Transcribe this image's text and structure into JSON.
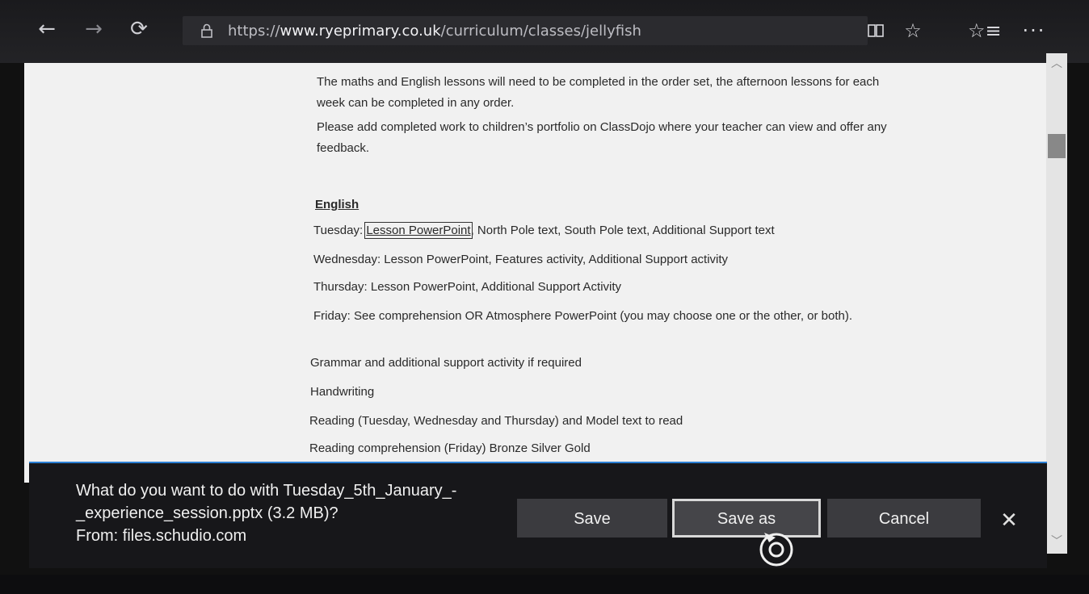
{
  "browser": {
    "url_prefix": "https://",
    "url_domain": "www.ryeprimary.co.uk",
    "url_path": "/curriculum/classes/jellyfish",
    "icons": {
      "back": "back-arrow-icon",
      "forward": "forward-arrow-icon",
      "refresh": "refresh-icon",
      "lock": "lock-icon",
      "reading_view": "reading-view-icon",
      "favorite": "star-icon",
      "favorites": "favorites-list-icon",
      "more": "more-icon"
    }
  },
  "page": {
    "intro_1a": "The maths and English lessons will need to be completed in the order set, the afternoon lessons for each",
    "intro_1b": "week can be completed in any order.",
    "intro_2a": "Please add completed work to children’s portfolio on ClassDojo where your teacher can view and offer any",
    "intro_2b": "feedback.",
    "english_heading": "English",
    "tuesday_label": "Tuesday: ",
    "tuesday_link": "Lesson PowerPoint",
    "tuesday_rest": ", North Pole text, South Pole text, Additional Support text",
    "wednesday": "Wednesday: Lesson PowerPoint, Features activity, Additional Support activity",
    "thursday": "Thursday: Lesson PowerPoint, Additional Support Activity",
    "friday": "Friday: See comprehension OR Atmosphere PowerPoint (you may choose one or the other, or both).",
    "grammar": "Grammar  and additional support activity if required",
    "handwriting": "Handwriting",
    "reading": "Reading (Tuesday, Wednesday and Thursday) and Model text to read",
    "reading_comp": "Reading comprehension (Friday) Bronze  Silver  Gold"
  },
  "download": {
    "line1": "What do you want to do with Tuesday_5th_January_-",
    "line2": "_experience_session.pptx (3.2 MB)?",
    "line3": "From: files.schudio.com",
    "save_label": "Save",
    "save_as_label": "Save as",
    "cancel_label": "Cancel",
    "close_icon": "close-icon"
  },
  "colors": {
    "accent": "#2a7fd4",
    "page_bg": "#f1f1f1",
    "bar_bg": "#17171a"
  }
}
